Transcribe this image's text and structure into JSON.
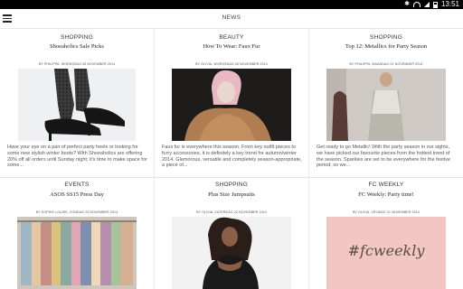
{
  "status": {
    "time": "13:51"
  },
  "appbar": {
    "title": "NEWS"
  },
  "articles": [
    {
      "category": "SHOPPING",
      "title": "Shoeaholics Sale Picks",
      "byline": "BY PHILIPPA, WOENSDAG 26 NOVEMBER 2014",
      "excerpt": "Have your eye on a pair of perfect party heels or looking for some new stylish winter boots? With Shoeaholics are offering 20% off all orders until Sunday night; it's time to make space for some..."
    },
    {
      "category": "BEAUTY",
      "title": "How To Wear: Faux Fur",
      "byline": "BY OLIVIA, WOENSDAG 26 NOVEMBER 2014",
      "excerpt": "Faux fur is everywhere this season. From key outfit pieces to furry accessories, it is definitely a key trend for autumn/winter 2014. Glamorous, versatile and completely season-appropriate, a piece of..."
    },
    {
      "category": "SHOPPING",
      "title": "Top 12: Metallics for Party Season",
      "byline": "BY PHILIPPA, MAANDAG 24 NOVEMBER 2014",
      "excerpt": "Get ready to go Metallic! With the party season in our sights, we have picked our favourite pieces from the hottest trend of the season. Sparkles are set to be everywhere for the festive period, so we..."
    },
    {
      "category": "EVENTS",
      "title": "ASOS SS15 Press Day",
      "byline": "BY SOPHIE LOUISE, ZONDAG 23 NOVEMBER 2014"
    },
    {
      "category": "SHOPPING",
      "title": "Plus Size Jumpsuits",
      "byline": "BY OLIVIA, ZATERDAG 22 NOVEMBER 2014"
    },
    {
      "category": "FC WEEKLY",
      "title": "FC Weekly: Party time!",
      "byline": "BY OLIVIA, VRIJDAG 21 NOVEMBER 2014",
      "image_text": "#fcweekly"
    }
  ]
}
